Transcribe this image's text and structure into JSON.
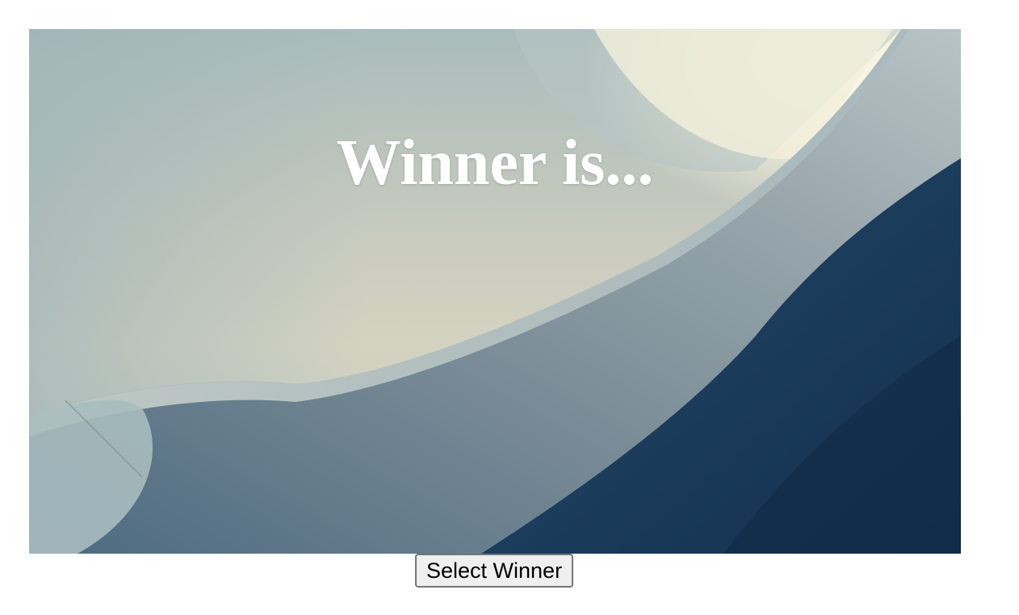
{
  "hero": {
    "headline": "Winner is..."
  },
  "actions": {
    "select_winner_label": "Select Winner"
  },
  "colors": {
    "headline_text": "#ffffff",
    "deep_blue": "#143450",
    "button_bg": "#efefef"
  }
}
